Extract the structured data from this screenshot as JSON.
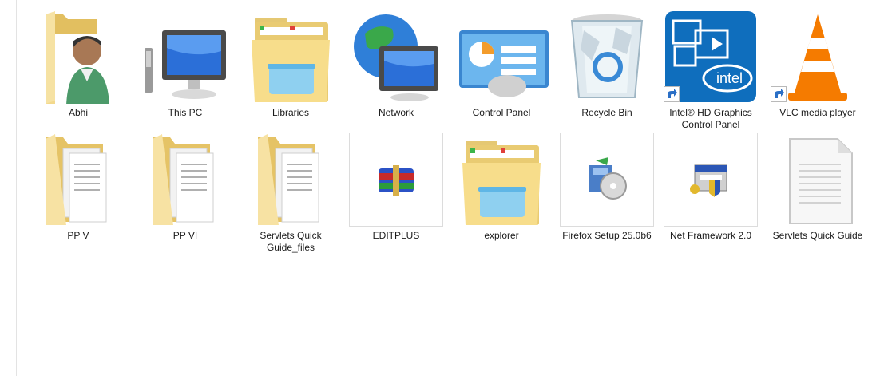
{
  "desktop": {
    "row1": [
      {
        "label": "Abhi",
        "icon": "user-folder-icon"
      },
      {
        "label": "This PC",
        "icon": "computer-icon"
      },
      {
        "label": "Libraries",
        "icon": "libraries-icon"
      },
      {
        "label": "Network",
        "icon": "network-globe-icon"
      },
      {
        "label": "Control Panel",
        "icon": "control-panel-icon"
      },
      {
        "label": "Recycle Bin",
        "icon": "recycle-bin-icon"
      },
      {
        "label": "Intel® HD Graphics Control Panel",
        "icon": "intel-graphics-icon"
      },
      {
        "label": "VLC media player",
        "icon": "vlc-cone-icon"
      }
    ],
    "row2": [
      {
        "label": "PP V",
        "icon": "document-folder-icon"
      },
      {
        "label": "PP VI",
        "icon": "document-folder-icon"
      },
      {
        "label": "Servlets Quick Guide_files",
        "icon": "document-folder-icon"
      },
      {
        "label": "EDITPLUS",
        "icon": "winrar-archive-icon"
      },
      {
        "label": "explorer",
        "icon": "explorer-folder-icon"
      },
      {
        "label": "Firefox Setup 25.0b6",
        "icon": "installer-icon"
      },
      {
        "label": "Net Framework 2.0",
        "icon": "setup-shield-icon"
      },
      {
        "label": "Servlets Quick Guide",
        "icon": "text-document-icon"
      }
    ]
  }
}
